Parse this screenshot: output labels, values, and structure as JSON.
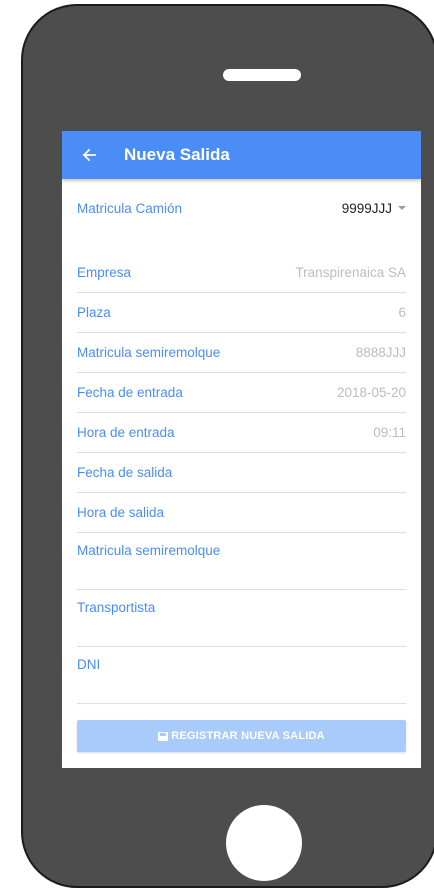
{
  "appbar": {
    "title": "Nueva Salida",
    "back_icon": "arrow-left-icon"
  },
  "colors": {
    "primary": "#4a8df6",
    "button_disabled": "#a9cbfb",
    "device": "#4d4d4d"
  },
  "form": {
    "truck_plate": {
      "label": "Matricula Camión",
      "value": "9999JJJ"
    },
    "company": {
      "label": "Empresa",
      "value": "Transpirenaica SA"
    },
    "slot": {
      "label": "Plaza",
      "value": "6"
    },
    "trailer_plate": {
      "label": "Matricula semiremolque",
      "value": "8888JJJ"
    },
    "entry_date": {
      "label": "Fecha de entrada",
      "value": "2018-05-20"
    },
    "entry_time": {
      "label": "Hora de entrada",
      "value": "09:11"
    },
    "exit_date": {
      "label": "Fecha de salida"
    },
    "exit_time": {
      "label": "Hora de salida"
    },
    "exit_trailer_plate": {
      "label": "Matricula semiremolque"
    },
    "carrier": {
      "label": "Transportista"
    },
    "dni": {
      "label": "DNI"
    }
  },
  "actions": {
    "submit_label": "REGISTRAR NUEVA SALIDA",
    "submit_icon": "save-icon"
  }
}
